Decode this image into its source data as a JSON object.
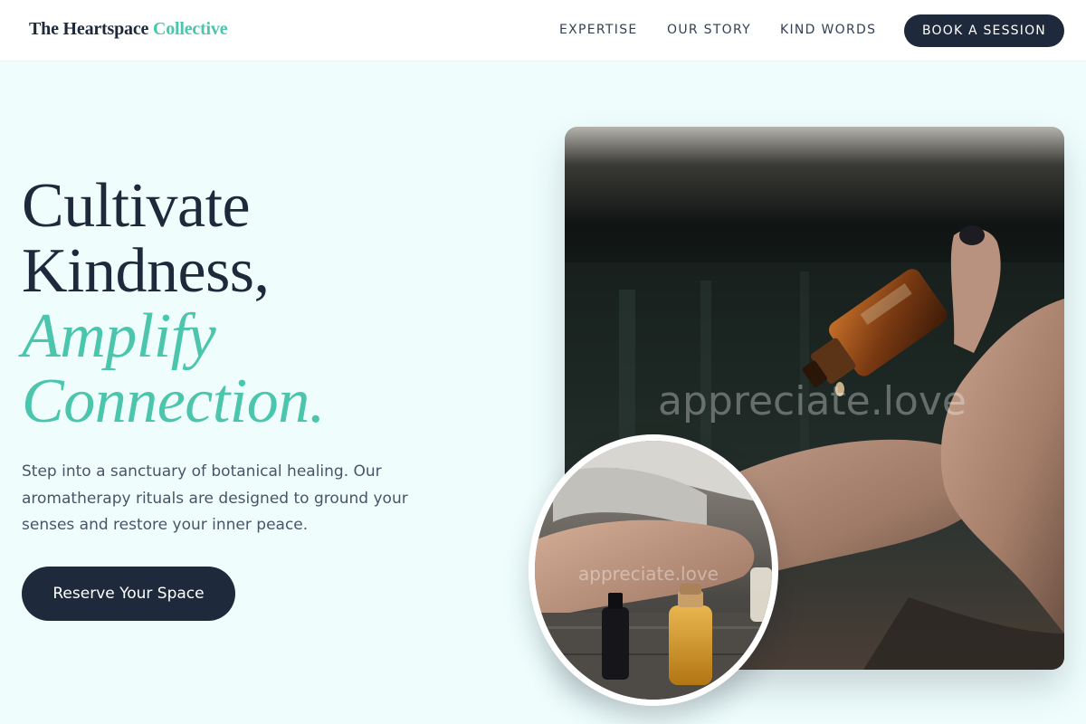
{
  "brand": {
    "name": "The Heartspace",
    "accent_name": "Collective"
  },
  "nav": {
    "expertise": "EXPERTISE",
    "our_story": "OUR STORY",
    "kind_words": "KIND WORDS",
    "cta": "BOOK A SESSION"
  },
  "hero": {
    "line1": "Cultivate",
    "line2": "Kindness,",
    "line3": "Amplify",
    "line4": "Connection.",
    "description": "Step into a sanctuary of botanical healing. Our aromatherapy rituals are designed to ground your senses and restore your inner peace.",
    "cta": "Reserve Your Space"
  },
  "images": {
    "main_watermark": "appreciate.love",
    "circle_watermark": "appreciate.love"
  },
  "colors": {
    "background": "#effefd",
    "navy": "#1e293b",
    "accent": "#4cc5ad",
    "body_text": "#475569"
  }
}
